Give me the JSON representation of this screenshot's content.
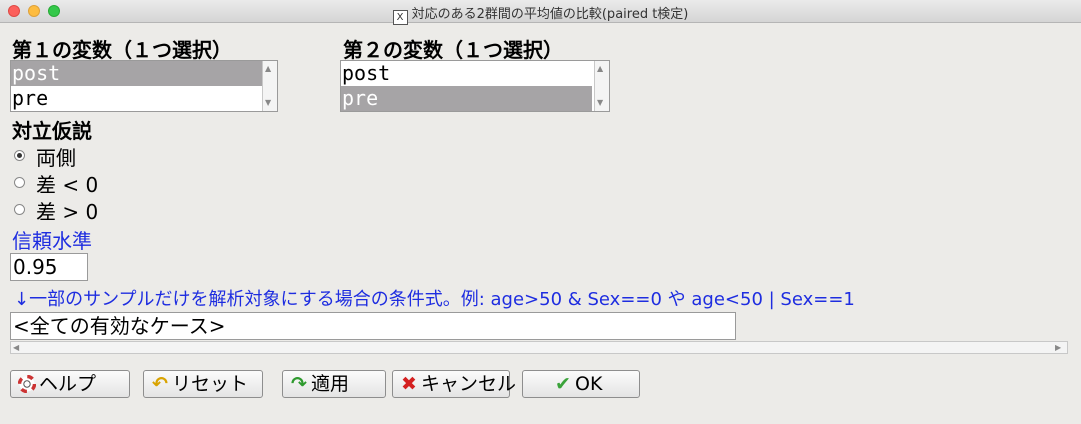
{
  "window": {
    "title": "対応のある2群間の平均値の比較(paired t検定)",
    "x_icon": "X"
  },
  "var1": {
    "heading": "第１の変数（１つ選択）",
    "items": [
      "post",
      "pre"
    ],
    "selected": 0
  },
  "var2": {
    "heading": "第２の変数（１つ選択）",
    "items": [
      "post",
      "pre"
    ],
    "selected": 1
  },
  "alt": {
    "heading": "対立仮説",
    "options": [
      "両側",
      "差 < 0",
      "差 > 0"
    ],
    "selected": 0
  },
  "conf": {
    "heading": "信頼水準",
    "value": "0.95"
  },
  "subset": {
    "hint": "↓一部のサンプルだけを解析対象にする場合の条件式。例: age>50 & Sex==0 や age<50 | Sex==1",
    "value": "<全ての有効なケース>"
  },
  "buttons": {
    "help": "ヘルプ",
    "reset": "リセット",
    "apply": "適用",
    "cancel": "キャンセル",
    "ok": "OK"
  },
  "icons": {
    "help": "lifebuoy-icon",
    "reset": "undo-arrow-icon",
    "apply": "redo-arrow-icon",
    "cancel": "red-x-icon",
    "ok": "checkmark-icon"
  },
  "colors": {
    "blue_text": "#1e2de0",
    "selection": "#a6a4a6"
  }
}
